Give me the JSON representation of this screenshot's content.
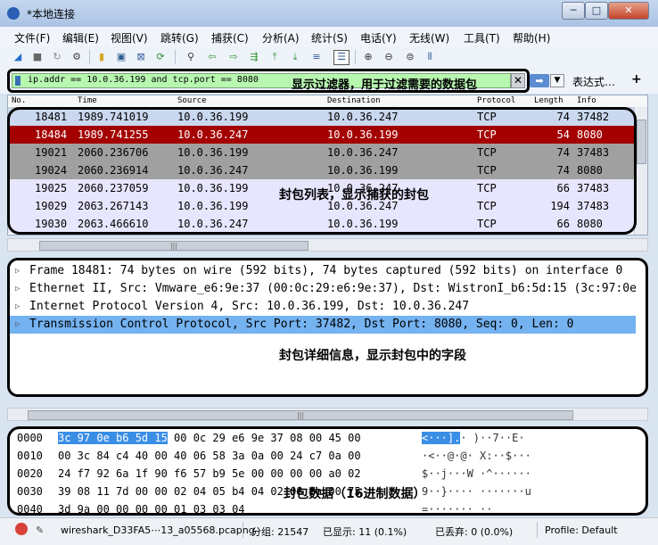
{
  "window": {
    "title": "*本地连接",
    "min_label": "─",
    "max_label": "□",
    "close_label": "✕"
  },
  "menu": [
    "文件(F)",
    "编辑(E)",
    "视图(V)",
    "跳转(G)",
    "捕获(C)",
    "分析(A)",
    "统计(S)",
    "电话(Y)",
    "无线(W)",
    "工具(T)",
    "帮助(H)"
  ],
  "filter": {
    "value": "ip.addr == 10.0.36.199 and tcp.port == 8080",
    "annotation": "显示过滤器，用于过滤需要的数据包",
    "clear_label": "✕",
    "apply_label": "➡",
    "dropdown_label": "▼",
    "expression_label": "表达式…",
    "add_label": "+"
  },
  "packet_list": {
    "columns": [
      "No.",
      "Time",
      "Source",
      "Destination",
      "Protocol",
      "Length",
      "Info"
    ],
    "rows": [
      {
        "no": "18481",
        "time": "1989.741019",
        "source": "10.0.36.199",
        "destination": "10.0.36.247",
        "protocol": "TCP",
        "length": "74",
        "info": "37482"
      },
      {
        "no": "18484",
        "time": "1989.741255",
        "source": "10.0.36.247",
        "destination": "10.0.36.199",
        "protocol": "TCP",
        "length": "54",
        "info": "8080"
      },
      {
        "no": "19021",
        "time": "2060.236706",
        "source": "10.0.36.199",
        "destination": "10.0.36.247",
        "protocol": "TCP",
        "length": "74",
        "info": "37483"
      },
      {
        "no": "19024",
        "time": "2060.236914",
        "source": "10.0.36.247",
        "destination": "10.0.36.199",
        "protocol": "TCP",
        "length": "74",
        "info": "8080"
      },
      {
        "no": "19025",
        "time": "2060.237059",
        "source": "10.0.36.199",
        "destination": "10.0.36.247",
        "protocol": "TCP",
        "length": "66",
        "info": "37483"
      },
      {
        "no": "19029",
        "time": "2063.267143",
        "source": "10.0.36.199",
        "destination": "10.0.36.247",
        "protocol": "TCP",
        "length": "194",
        "info": "37483"
      },
      {
        "no": "19030",
        "time": "2063.466610",
        "source": "10.0.36.247",
        "destination": "10.0.36.199",
        "protocol": "TCP",
        "length": "66",
        "info": "8080"
      }
    ],
    "annotation": "封包列表，显示捕获的封包",
    "scroll_label": "|||"
  },
  "details": {
    "rows": [
      "Frame 18481: 74 bytes on wire (592 bits), 74 bytes captured (592 bits) on interface 0",
      "Ethernet II, Src: Vmware_e6:9e:37 (00:0c:29:e6:9e:37), Dst: WistronI_b6:5d:15 (3c:97:0e",
      "Internet Protocol Version 4, Src: 10.0.36.199, Dst: 10.0.36.247",
      "Transmission Control Protocol, Src Port: 37482, Dst Port: 8080, Seq: 0, Len: 0"
    ],
    "annotation": "封包详细信息，显示封包中的字段",
    "scroll_label": "|||"
  },
  "bytes": {
    "rows": [
      {
        "offset": "0000",
        "hex_hl": "3c 97 0e b6 5d 15",
        "hex": " 00 0c  29 e6 9e 37 08 00 45 00",
        "ascii_hl": "<···].",
        "ascii": "· )··7··E·"
      },
      {
        "offset": "0010",
        "hex_hl": "",
        "hex": "00 3c 84 c4 40 00 40 06  58 3a 0a 00 24 c7 0a 00",
        "ascii_hl": "",
        "ascii": "·<··@·@· X:··$···"
      },
      {
        "offset": "0020",
        "hex_hl": "",
        "hex": "24 f7 92 6a 1f 90 f6 57  b9 5e 00 00 00 00 a0 02",
        "ascii_hl": "",
        "ascii": "$··j···W ·^······"
      },
      {
        "offset": "0030",
        "hex_hl": "",
        "hex": "39 08 11 7d 00 00 02 04  05 b4 04 02 08 0a 00 75",
        "ascii_hl": "",
        "ascii": "9··}···· ·······u"
      },
      {
        "offset": "0040",
        "hex_hl": "",
        "hex": "3d 9a 00 00 00 00 01 03  03 04",
        "ascii_hl": "",
        "ascii": "=······· ··"
      }
    ],
    "annotation": "封包数据（16进制数据）"
  },
  "status": {
    "file": "wireshark_D33FA5⋯13_a05568.pcapng",
    "packets": "分组: 21547",
    "displayed": "已显示: 11 (0.1%)",
    "dropped": "已丢弃: 0 (0.0%)",
    "profile": "Profile: Default"
  },
  "colors": {
    "selected_row": "#a40000",
    "gray_row": "#a0a0a0",
    "light_row": "#e7e6ff",
    "filter_bg": "#b7f7b0",
    "highlight": "#3a8ee6"
  }
}
